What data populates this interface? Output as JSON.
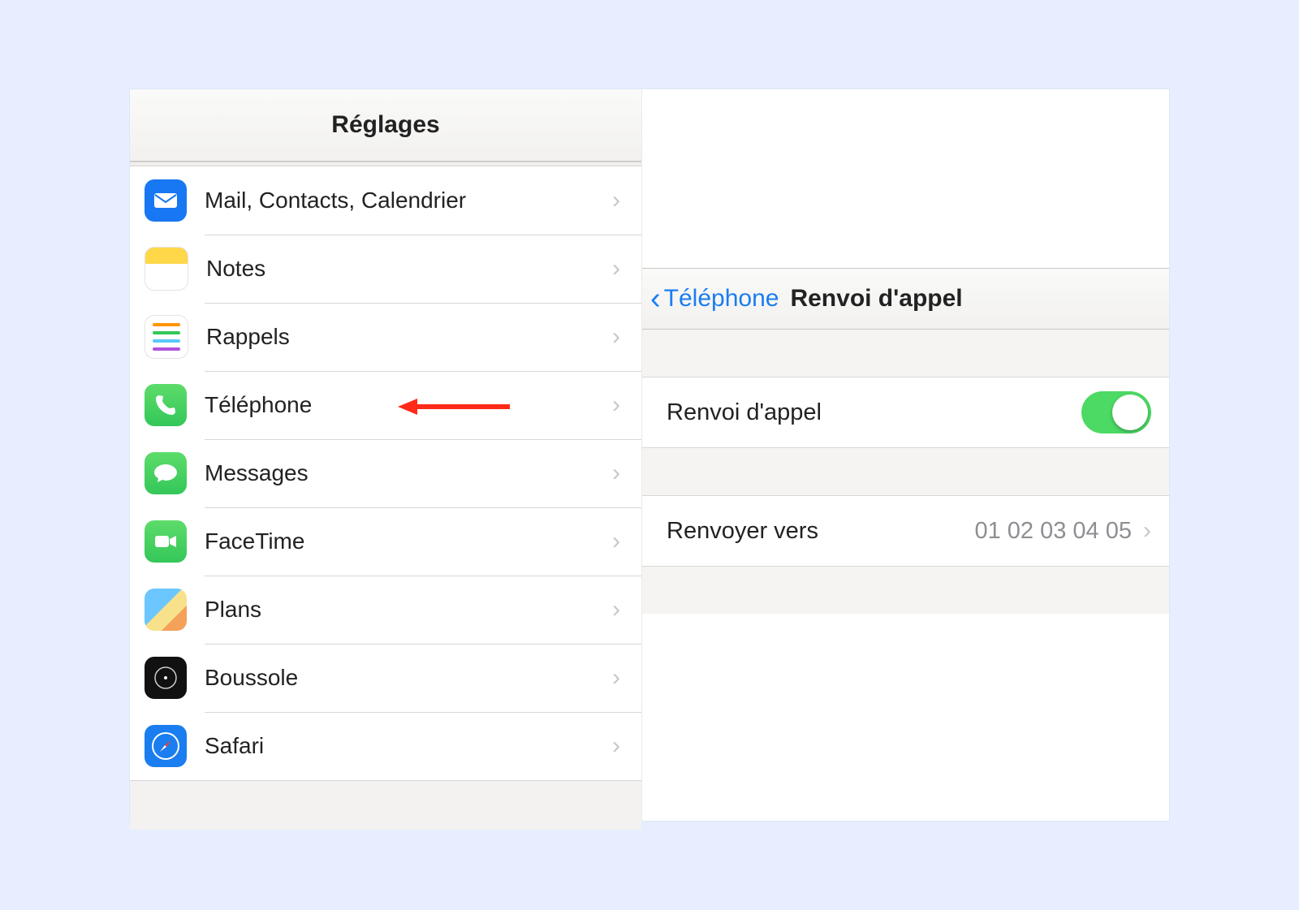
{
  "left": {
    "title": "Réglages",
    "items": [
      {
        "label": "Mail, Contacts, Calendrier",
        "icon": "mail"
      },
      {
        "label": "Notes",
        "icon": "notes"
      },
      {
        "label": "Rappels",
        "icon": "reminders"
      },
      {
        "label": "Téléphone",
        "icon": "phone"
      },
      {
        "label": "Messages",
        "icon": "messages"
      },
      {
        "label": "FaceTime",
        "icon": "facetime"
      },
      {
        "label": "Plans",
        "icon": "maps"
      },
      {
        "label": "Boussole",
        "icon": "compass"
      },
      {
        "label": "Safari",
        "icon": "safari"
      }
    ]
  },
  "right": {
    "back_label": "Téléphone",
    "title": "Renvoi d'appel",
    "toggle_label": "Renvoi d'appel",
    "toggle_on": true,
    "forward_label": "Renvoyer vers",
    "forward_value": "01 02 03 04 05"
  }
}
